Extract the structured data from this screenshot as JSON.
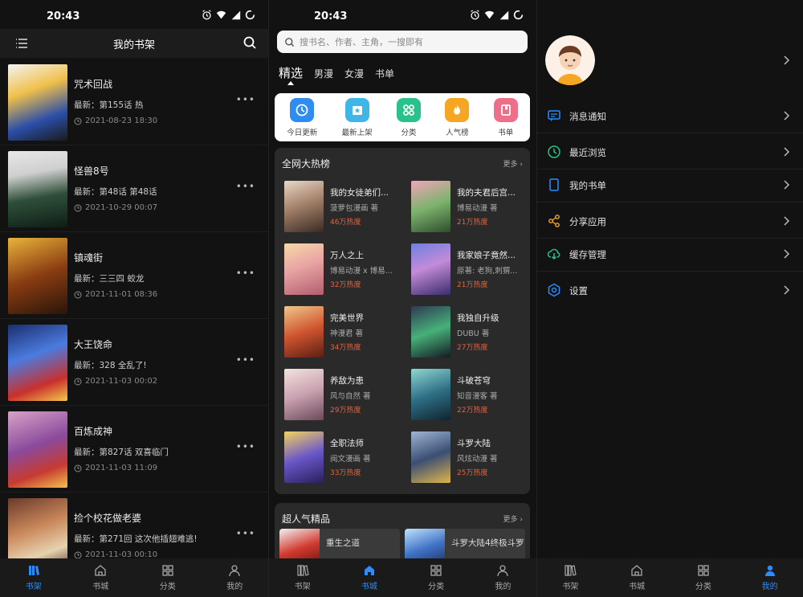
{
  "status": {
    "time": "20:43"
  },
  "colors": {
    "accent": "#2a8cff",
    "heat": "#e8623b",
    "background": "#121212"
  },
  "bottom_nav": {
    "shelf": "书架",
    "store": "书城",
    "category": "分类",
    "mine": "我的"
  },
  "shelf_page": {
    "title": "我的书架",
    "items": [
      {
        "title": "咒术回战",
        "latest": "最新：第155话 热",
        "date": "2021-08-23 18:30"
      },
      {
        "title": "怪兽8号",
        "latest": "最新：第48话 第48话",
        "date": "2021-10-29 00:07"
      },
      {
        "title": "镇魂街",
        "latest": "最新：三三四 蛟龙",
        "date": "2021-11-01 08:36"
      },
      {
        "title": "大王饶命",
        "latest": "最新：328 全乱了!",
        "date": "2021-11-03 00:02"
      },
      {
        "title": "百炼成神",
        "latest": "最新：第827话 双喜临门",
        "date": "2021-11-03 11:09"
      },
      {
        "title": "捡个校花做老婆",
        "latest": "最新：第271回 这次他插翅难逃!",
        "date": "2021-11-03 00:10"
      }
    ]
  },
  "store_page": {
    "search_placeholder": "搜书名、作者、主角，一搜即有",
    "tabs": [
      "精选",
      "男漫",
      "女漫",
      "书单"
    ],
    "quick_links": [
      {
        "label": "今日更新",
        "icon": "clock-icon",
        "color": "#2f8cf0"
      },
      {
        "label": "最新上架",
        "icon": "star-icon",
        "color": "#3fb6e8"
      },
      {
        "label": "分类",
        "icon": "grid-icon",
        "color": "#29c28a"
      },
      {
        "label": "人气榜",
        "icon": "flame-icon",
        "color": "#f5a623"
      },
      {
        "label": "书单",
        "icon": "book-icon",
        "color": "#ef6f8a"
      }
    ],
    "ranking": {
      "title": "全网大热榜",
      "more": "更多",
      "items": [
        {
          "name": "我的女徒弟们...",
          "author": "菠萝包漫画 著",
          "heat": "46万热度"
        },
        {
          "name": "我的夫君后宫...",
          "author": "博易动漫 著",
          "heat": "21万热度"
        },
        {
          "name": "万人之上",
          "author": "博易动漫 x 博易...",
          "heat": "32万热度"
        },
        {
          "name": "我家娘子竟然...",
          "author": "原著: 老狗,刺猬...",
          "heat": "21万热度"
        },
        {
          "name": "完美世界",
          "author": "神漫君 著",
          "heat": "34万热度"
        },
        {
          "name": "我独自升级",
          "author": "DUBU 著",
          "heat": "27万热度"
        },
        {
          "name": "养敌为患",
          "author": "风与自然 著",
          "heat": "29万热度"
        },
        {
          "name": "斗破苍穹",
          "author": "知音漫客 著",
          "heat": "22万热度"
        },
        {
          "name": "全职法师",
          "author": "阅文漫画 著",
          "heat": "33万热度"
        },
        {
          "name": "斗罗大陆",
          "author": "风炫动漫 著",
          "heat": "25万热度"
        }
      ]
    },
    "popular": {
      "title": "超人气精品",
      "more": "更多",
      "items": [
        {
          "name": "重生之道"
        },
        {
          "name": "斗罗大陆4终极斗罗"
        }
      ]
    }
  },
  "mine_page": {
    "menu": [
      {
        "label": "消息通知",
        "icon": "message-icon"
      },
      {
        "label": "最近浏览",
        "icon": "history-icon"
      },
      {
        "label": "我的书单",
        "icon": "booklist-icon"
      },
      {
        "label": "分享应用",
        "icon": "share-icon"
      },
      {
        "label": "缓存管理",
        "icon": "cloud-download-icon"
      },
      {
        "label": "设置",
        "icon": "settings-icon"
      }
    ]
  }
}
